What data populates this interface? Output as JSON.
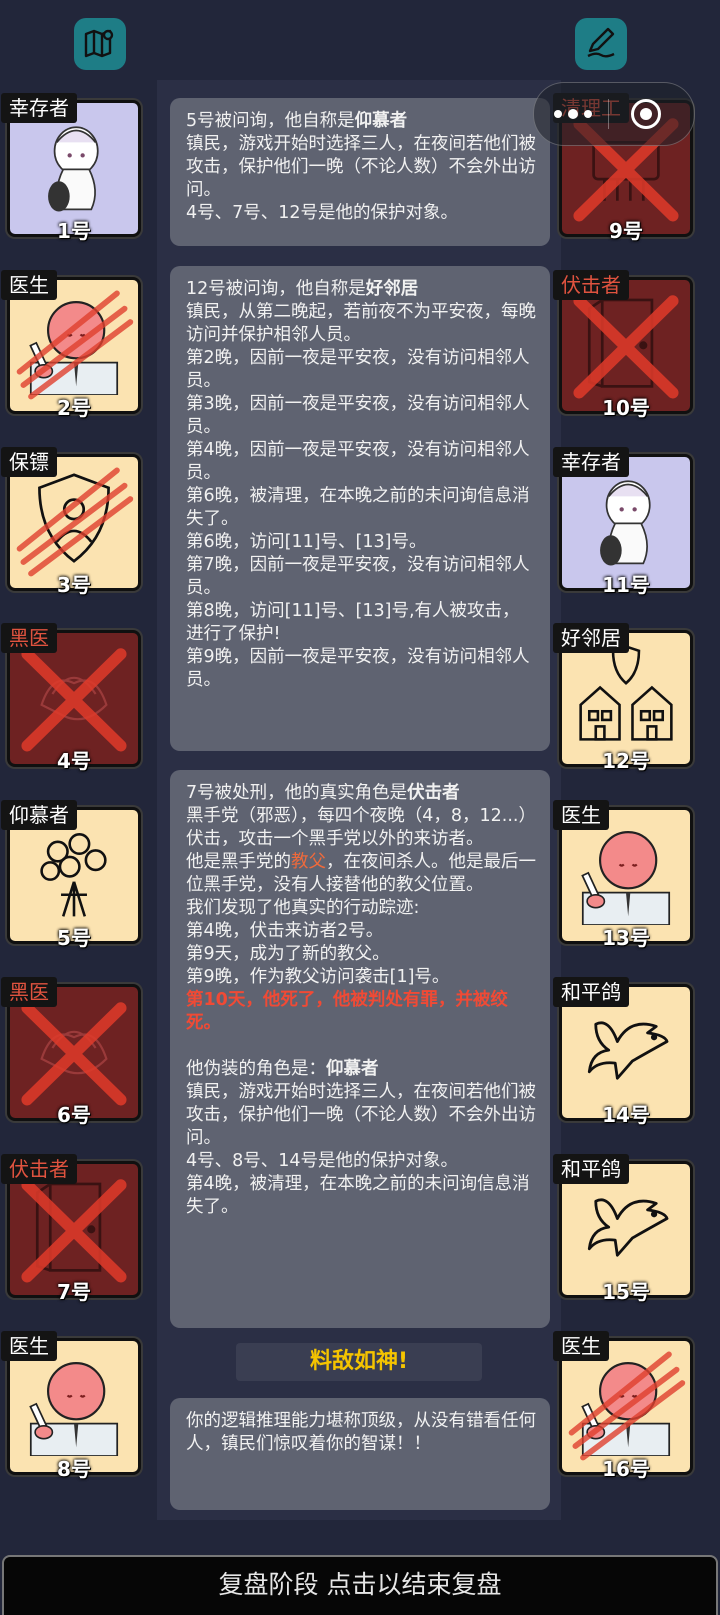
{
  "players_left": [
    {
      "role": "幸存者",
      "num": "1号",
      "art": "survivor",
      "status": "alive"
    },
    {
      "role": "医生",
      "num": "2号",
      "art": "doctor",
      "status": "slashed"
    },
    {
      "role": "保镖",
      "num": "3号",
      "art": "bodyguard",
      "status": "slashed"
    },
    {
      "role": "黑医",
      "num": "4号",
      "art": "blackdoc",
      "status": "dead"
    },
    {
      "role": "仰慕者",
      "num": "5号",
      "art": "admirer",
      "status": "alive"
    },
    {
      "role": "黑医",
      "num": "6号",
      "art": "blackdoc",
      "status": "dead"
    },
    {
      "role": "伏击者",
      "num": "7号",
      "art": "ambusher",
      "status": "dead"
    },
    {
      "role": "医生",
      "num": "8号",
      "art": "doctor",
      "status": "alive"
    }
  ],
  "players_right": [
    {
      "role": "清理工",
      "num": "9号",
      "art": "cleaner",
      "status": "dead"
    },
    {
      "role": "伏击者",
      "num": "10号",
      "art": "ambusher",
      "status": "dead"
    },
    {
      "role": "幸存者",
      "num": "11号",
      "art": "survivor",
      "status": "alive"
    },
    {
      "role": "好邻居",
      "num": "12号",
      "art": "neighbor",
      "status": "alive"
    },
    {
      "role": "医生",
      "num": "13号",
      "art": "doctor",
      "status": "alive"
    },
    {
      "role": "和平鸽",
      "num": "14号",
      "art": "dove",
      "status": "alive"
    },
    {
      "role": "和平鸽",
      "num": "15号",
      "art": "dove",
      "status": "alive"
    },
    {
      "role": "医生",
      "num": "16号",
      "art": "doctor",
      "status": "slashed"
    }
  ],
  "messages": {
    "m1": {
      "prefix": "5号被问询，他自称是",
      "role": "仰慕者",
      "lines": [
        "镇民，游戏开始时选择三人，在夜间若他们被攻击，保护他们一晚（不论人数）不会外出访问。",
        "4号、7号、12号是他的保护对象。"
      ]
    },
    "m2": {
      "prefix": "12号被问询，他自称是",
      "role": "好邻居",
      "lines": [
        "镇民，从第二晚起，若前夜不为平安夜，每晚访问并保护相邻人员。",
        "第2晚，因前一夜是平安夜，没有访问相邻人员。",
        "第3晚，因前一夜是平安夜，没有访问相邻人员。",
        "第4晚，因前一夜是平安夜，没有访问相邻人员。",
        "第6晚，被清理，在本晚之前的未问询信息消失了。",
        "第6晚，访问[11]号、[13]号。",
        "第7晚，因前一夜是平安夜，没有访问相邻人员。",
        "第8晚，访问[11]号、[13]号,有人被攻击，进行了保护!",
        "第9晚，因前一夜是平安夜，没有访问相邻人员。"
      ]
    },
    "m3": {
      "prefix": "7号被处刑，他的真实角色是",
      "role": "伏击者",
      "desc": "黑手党（邪恶），每四个夜晚（4，8，12...）伏击，攻击一个黑手党以外的来访者。",
      "godfather_pre": "他是黑手党的",
      "godfather": "教父",
      "godfather_post": "，在夜间杀人。他是最后一位黑手党，没有人接替他的教父位置。",
      "track_title": "我们发现了他真实的行动踪迹:",
      "track": [
        "第4晚，伏击来访者2号。",
        "第9天，成为了新的教父。",
        "第9晚，作为教父访问袭击[1]号。"
      ],
      "death": "第10天，他死了，他被判处有罪，并被绞死。",
      "fake_pre": "他伪装的角色是：",
      "fake_role": "仰慕者",
      "fake_lines": [
        "镇民，游戏开始时选择三人，在夜间若他们被攻击，保护他们一晚（不论人数）不会外出访问。",
        "4号、8号、14号是他的保护对象。",
        "第4晚，被清理，在本晚之前的未问询信息消失了。"
      ]
    },
    "m4": {
      "text": "你的逻辑推理能力堪称顶级，从没有错看任何人，镇民们惊叹着你的智谋！！"
    }
  },
  "banner": "料敌如神!",
  "bottom_bar": "复盘阶段 点击以结束复盘",
  "icons": {
    "top_left": "map-icon",
    "top_right": "notepad-pen-icon"
  },
  "colors": {
    "accent_teal": "#1e7d86",
    "card_bg": "#fbe3b1",
    "danger_red": "#f04a35",
    "banner_gold": "#f5c400"
  }
}
